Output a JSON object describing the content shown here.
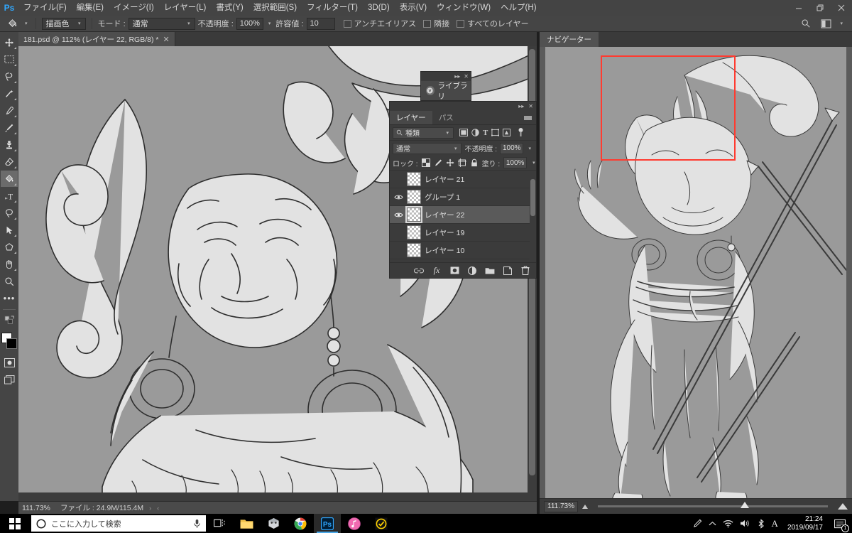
{
  "app": {
    "logo": "Ps",
    "menus": [
      "ファイル(F)",
      "編集(E)",
      "イメージ(I)",
      "レイヤー(L)",
      "書式(Y)",
      "選択範囲(S)",
      "フィルター(T)",
      "3D(D)",
      "表示(V)",
      "ウィンドウ(W)",
      "ヘルプ(H)"
    ],
    "window_controls": {
      "minimize": "—",
      "restore": "❐",
      "close": "✕"
    }
  },
  "options_bar": {
    "tool_icon": "paint-bucket-icon",
    "fill_source_label": "",
    "fill_source_value": "描画色",
    "mode_label": "モード :",
    "mode_value": "通常",
    "opacity_label": "不透明度 :",
    "opacity_value": "100%",
    "tolerance_label": "許容値 :",
    "tolerance_value": "10",
    "antialias_label": "アンチエイリアス",
    "contiguous_label": "隣接",
    "all_layers_label": "すべてのレイヤー",
    "search_icon": "search-icon",
    "workspace_icon": "workspace-icon"
  },
  "toolbar": {
    "tools": [
      {
        "name": "move-tool",
        "glyph": "✥",
        "active": false
      },
      {
        "name": "marquee-tool",
        "glyph": "▭",
        "active": false
      },
      {
        "name": "lasso-tool",
        "glyph": "◯",
        "active": false
      },
      {
        "name": "magic-wand-tool",
        "glyph": "✧",
        "active": false
      },
      {
        "name": "eyedropper-tool",
        "glyph": "⚲",
        "active": false
      },
      {
        "name": "brush-tool",
        "glyph": "✎",
        "active": false
      },
      {
        "name": "clone-stamp-tool",
        "glyph": "⚱",
        "active": false
      },
      {
        "name": "eraser-tool",
        "glyph": "◣",
        "active": false
      },
      {
        "name": "paint-bucket-tool",
        "glyph": "◐",
        "active": true
      },
      {
        "name": "type-tool",
        "glyph": "T",
        "active": false
      },
      {
        "name": "pen-tool",
        "glyph": "✒",
        "active": false
      },
      {
        "name": "path-selection-tool",
        "glyph": "➤",
        "active": false
      },
      {
        "name": "shape-tool",
        "glyph": "⬡",
        "active": false
      },
      {
        "name": "hand-tool",
        "glyph": "✋",
        "active": false
      },
      {
        "name": "zoom-tool",
        "glyph": "⚲",
        "active": false
      }
    ],
    "more_tools": "•••",
    "foreground_color": "#ffffff",
    "background_color": "#000000",
    "quickmask_icon": "quick-mask-icon",
    "screenmode_icon": "screen-mode-icon"
  },
  "document": {
    "tab_title": "181.psd @ 112% (レイヤー 22, RGB/8) *",
    "tab_close": "✕",
    "canvas_background": "#9a9a9a"
  },
  "status_bar": {
    "zoom": "111.73%",
    "file_info": "ファイル : 24.9M/115.4M",
    "arrow_right": "›",
    "arrow_left": "‹"
  },
  "library_panel": {
    "tab_label": "ライブラリ",
    "cc_icon": "creative-cloud-icon",
    "collapse": "▸▸",
    "close": "✕"
  },
  "layers_panel": {
    "collapse": "▸▸",
    "close": "✕",
    "tabs": [
      {
        "label": "レイヤー",
        "active": true
      },
      {
        "label": "パス",
        "active": false
      }
    ],
    "menu_icon": "panel-menu-icon",
    "filter": {
      "search_icon": "search-icon",
      "kind_value": "種類",
      "icons": [
        "filter-pixel-icon",
        "filter-adjustment-icon",
        "filter-type-icon",
        "filter-shape-icon",
        "filter-smartobject-icon"
      ],
      "toggle_icon": "filter-toggle-icon"
    },
    "blend_mode": "通常",
    "opacity_label": "不透明度 :",
    "opacity_value": "100%",
    "lock_label": "ロック :",
    "lock_icons": [
      "lock-transparent-icon",
      "lock-image-icon",
      "lock-position-icon",
      "lock-artboard-icon",
      "lock-all-icon"
    ],
    "fill_label": "塗り :",
    "fill_value": "100%",
    "layers": [
      {
        "name": "レイヤー 21",
        "visible": false,
        "selected": false
      },
      {
        "name": "グループ 1",
        "visible": true,
        "selected": false
      },
      {
        "name": "レイヤー 22",
        "visible": true,
        "selected": true
      },
      {
        "name": "レイヤー 19",
        "visible": false,
        "selected": false
      },
      {
        "name": "レイヤー 10",
        "visible": false,
        "selected": false
      }
    ],
    "footer_icons": [
      "link-layers-icon",
      "layer-styles-icon",
      "layer-mask-icon",
      "adjustment-layer-icon",
      "new-group-icon",
      "new-layer-icon",
      "delete-layer-icon"
    ]
  },
  "navigator_panel": {
    "tab_label": "ナビゲーター",
    "zoom_value": "111.73%",
    "zoom_out_icon": "zoom-out-icon",
    "zoom_in_icon": "zoom-in-icon",
    "view_box_color": "#ff3b30"
  },
  "taskbar": {
    "start_icon": "windows-start-icon",
    "search_placeholder": "ここに入力して検索",
    "cortana_icon": "cortana-icon",
    "mic_icon": "microphone-icon",
    "taskview_icon": "task-view-icon",
    "apps": [
      {
        "name": "file-explorer-icon",
        "active": false
      },
      {
        "name": "app-icon-dark",
        "active": false
      },
      {
        "name": "chrome-icon",
        "active": false
      },
      {
        "name": "photoshop-icon",
        "active": true
      },
      {
        "name": "itunes-icon",
        "active": false
      },
      {
        "name": "norton-icon",
        "active": false
      }
    ],
    "tray": [
      "pen-tray-icon",
      "chevron-up-icon",
      "wifi-icon",
      "volume-icon",
      "bluetooth-icon",
      "ime-icon"
    ],
    "clock_time": "21:24",
    "clock_date": "2019/09/17",
    "notification_icon": "notification-icon",
    "notification_count": "1"
  }
}
